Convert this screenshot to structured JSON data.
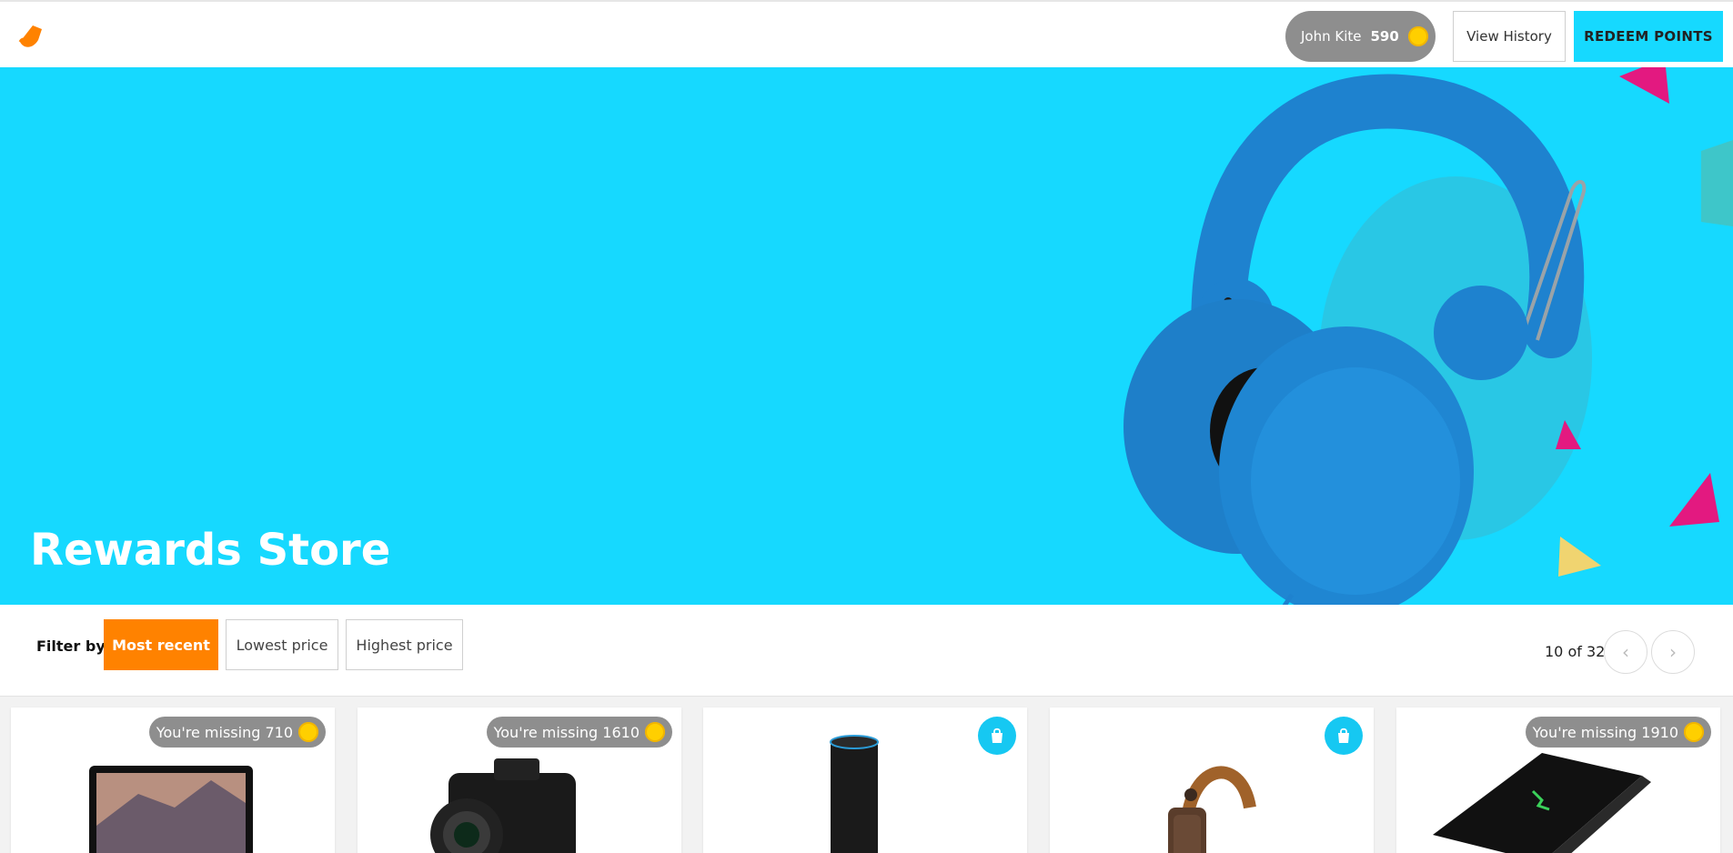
{
  "header": {
    "user_name": "John Kite",
    "user_points": "590",
    "view_history_label": "View History",
    "redeem_label": "REDEEM POINTS"
  },
  "hero": {
    "title": "Rewards Store"
  },
  "filters": {
    "label": "Filter by:",
    "options": [
      "Most recent",
      "Lowest price",
      "Highest price"
    ],
    "active": "Most recent"
  },
  "pager": {
    "text": "10 of 32"
  },
  "products": [
    {
      "badge": "You're missing 710",
      "icon": "laptop-icon"
    },
    {
      "badge": "You're missing 1610",
      "icon": "camera-icon"
    },
    {
      "badge": "",
      "icon": "smart-speaker-icon",
      "redeemable": true
    },
    {
      "badge": "",
      "icon": "headphones-icon",
      "redeemable": true
    },
    {
      "badge": "You're missing 1910",
      "icon": "gaming-laptop-icon"
    }
  ],
  "colors": {
    "accent": "#16d9ff",
    "orange": "#ff8200",
    "coin": "#ffcf00",
    "pill": "#8e8e8e"
  }
}
